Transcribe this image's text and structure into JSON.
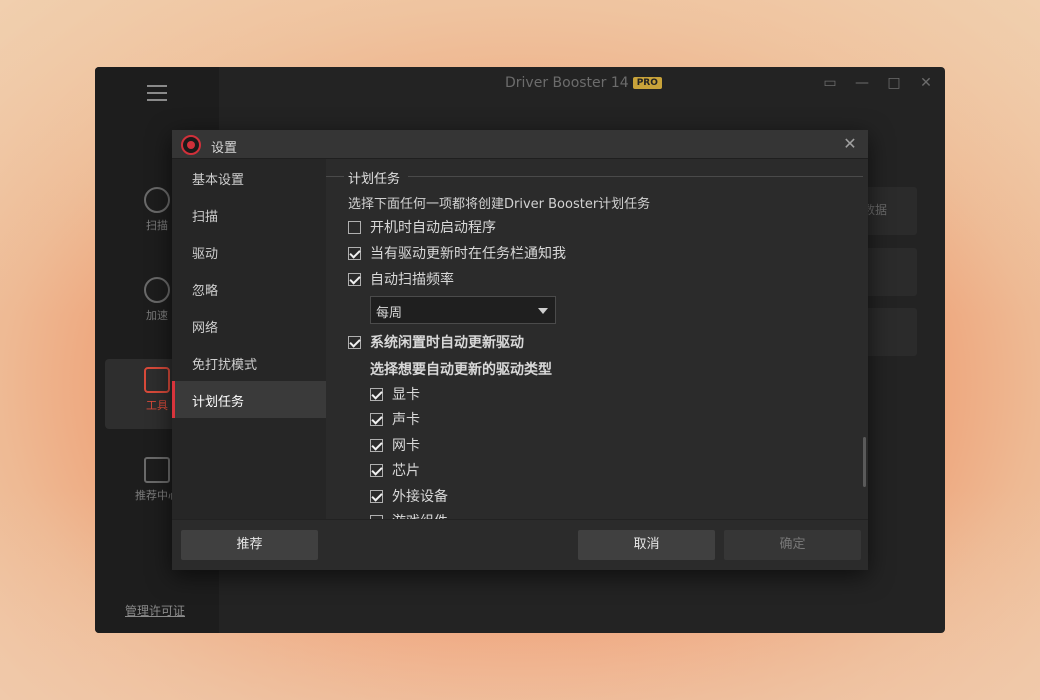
{
  "app": {
    "title": "Driver Booster 14",
    "pro_badge": "PRO",
    "license_link": "管理许可证",
    "nav": [
      {
        "label": "扫描",
        "icon": "scan-icon"
      },
      {
        "label": "加速",
        "icon": "speedometer-icon"
      },
      {
        "label": "工具",
        "icon": "toolbox-icon"
      },
      {
        "label": "推荐中心",
        "icon": "apps-grid-icon"
      }
    ],
    "card_label": "数据"
  },
  "dialog": {
    "title": "设置",
    "nav": [
      {
        "label": "基本设置"
      },
      {
        "label": "扫描"
      },
      {
        "label": "驱动"
      },
      {
        "label": "忽略"
      },
      {
        "label": "网络"
      },
      {
        "label": "免打扰模式"
      },
      {
        "label": "计划任务"
      }
    ],
    "active_nav": "计划任务",
    "section_title": "计划任务",
    "description": "选择下面任何一项都将创建Driver Booster计划任务",
    "options": {
      "auto_start": {
        "label": "开机时自动启动程序",
        "checked": false
      },
      "notify_taskbar": {
        "label": "当有驱动更新时在任务栏通知我",
        "checked": true
      },
      "auto_scan": {
        "label": "自动扫描频率",
        "checked": true
      },
      "auto_scan_frequency": "每周",
      "idle_update": {
        "label": "系统闲置时自动更新驱动",
        "checked": true
      }
    },
    "driver_types_title": "选择想要自动更新的驱动类型",
    "driver_types": [
      {
        "label": "显卡",
        "checked": true
      },
      {
        "label": "声卡",
        "checked": true
      },
      {
        "label": "网卡",
        "checked": true
      },
      {
        "label": "芯片",
        "checked": true
      },
      {
        "label": "外接设备",
        "checked": true
      },
      {
        "label": "游戏组件",
        "checked": false
      }
    ],
    "buttons": {
      "recommend": "推荐",
      "cancel": "取消",
      "ok": "确定"
    }
  }
}
